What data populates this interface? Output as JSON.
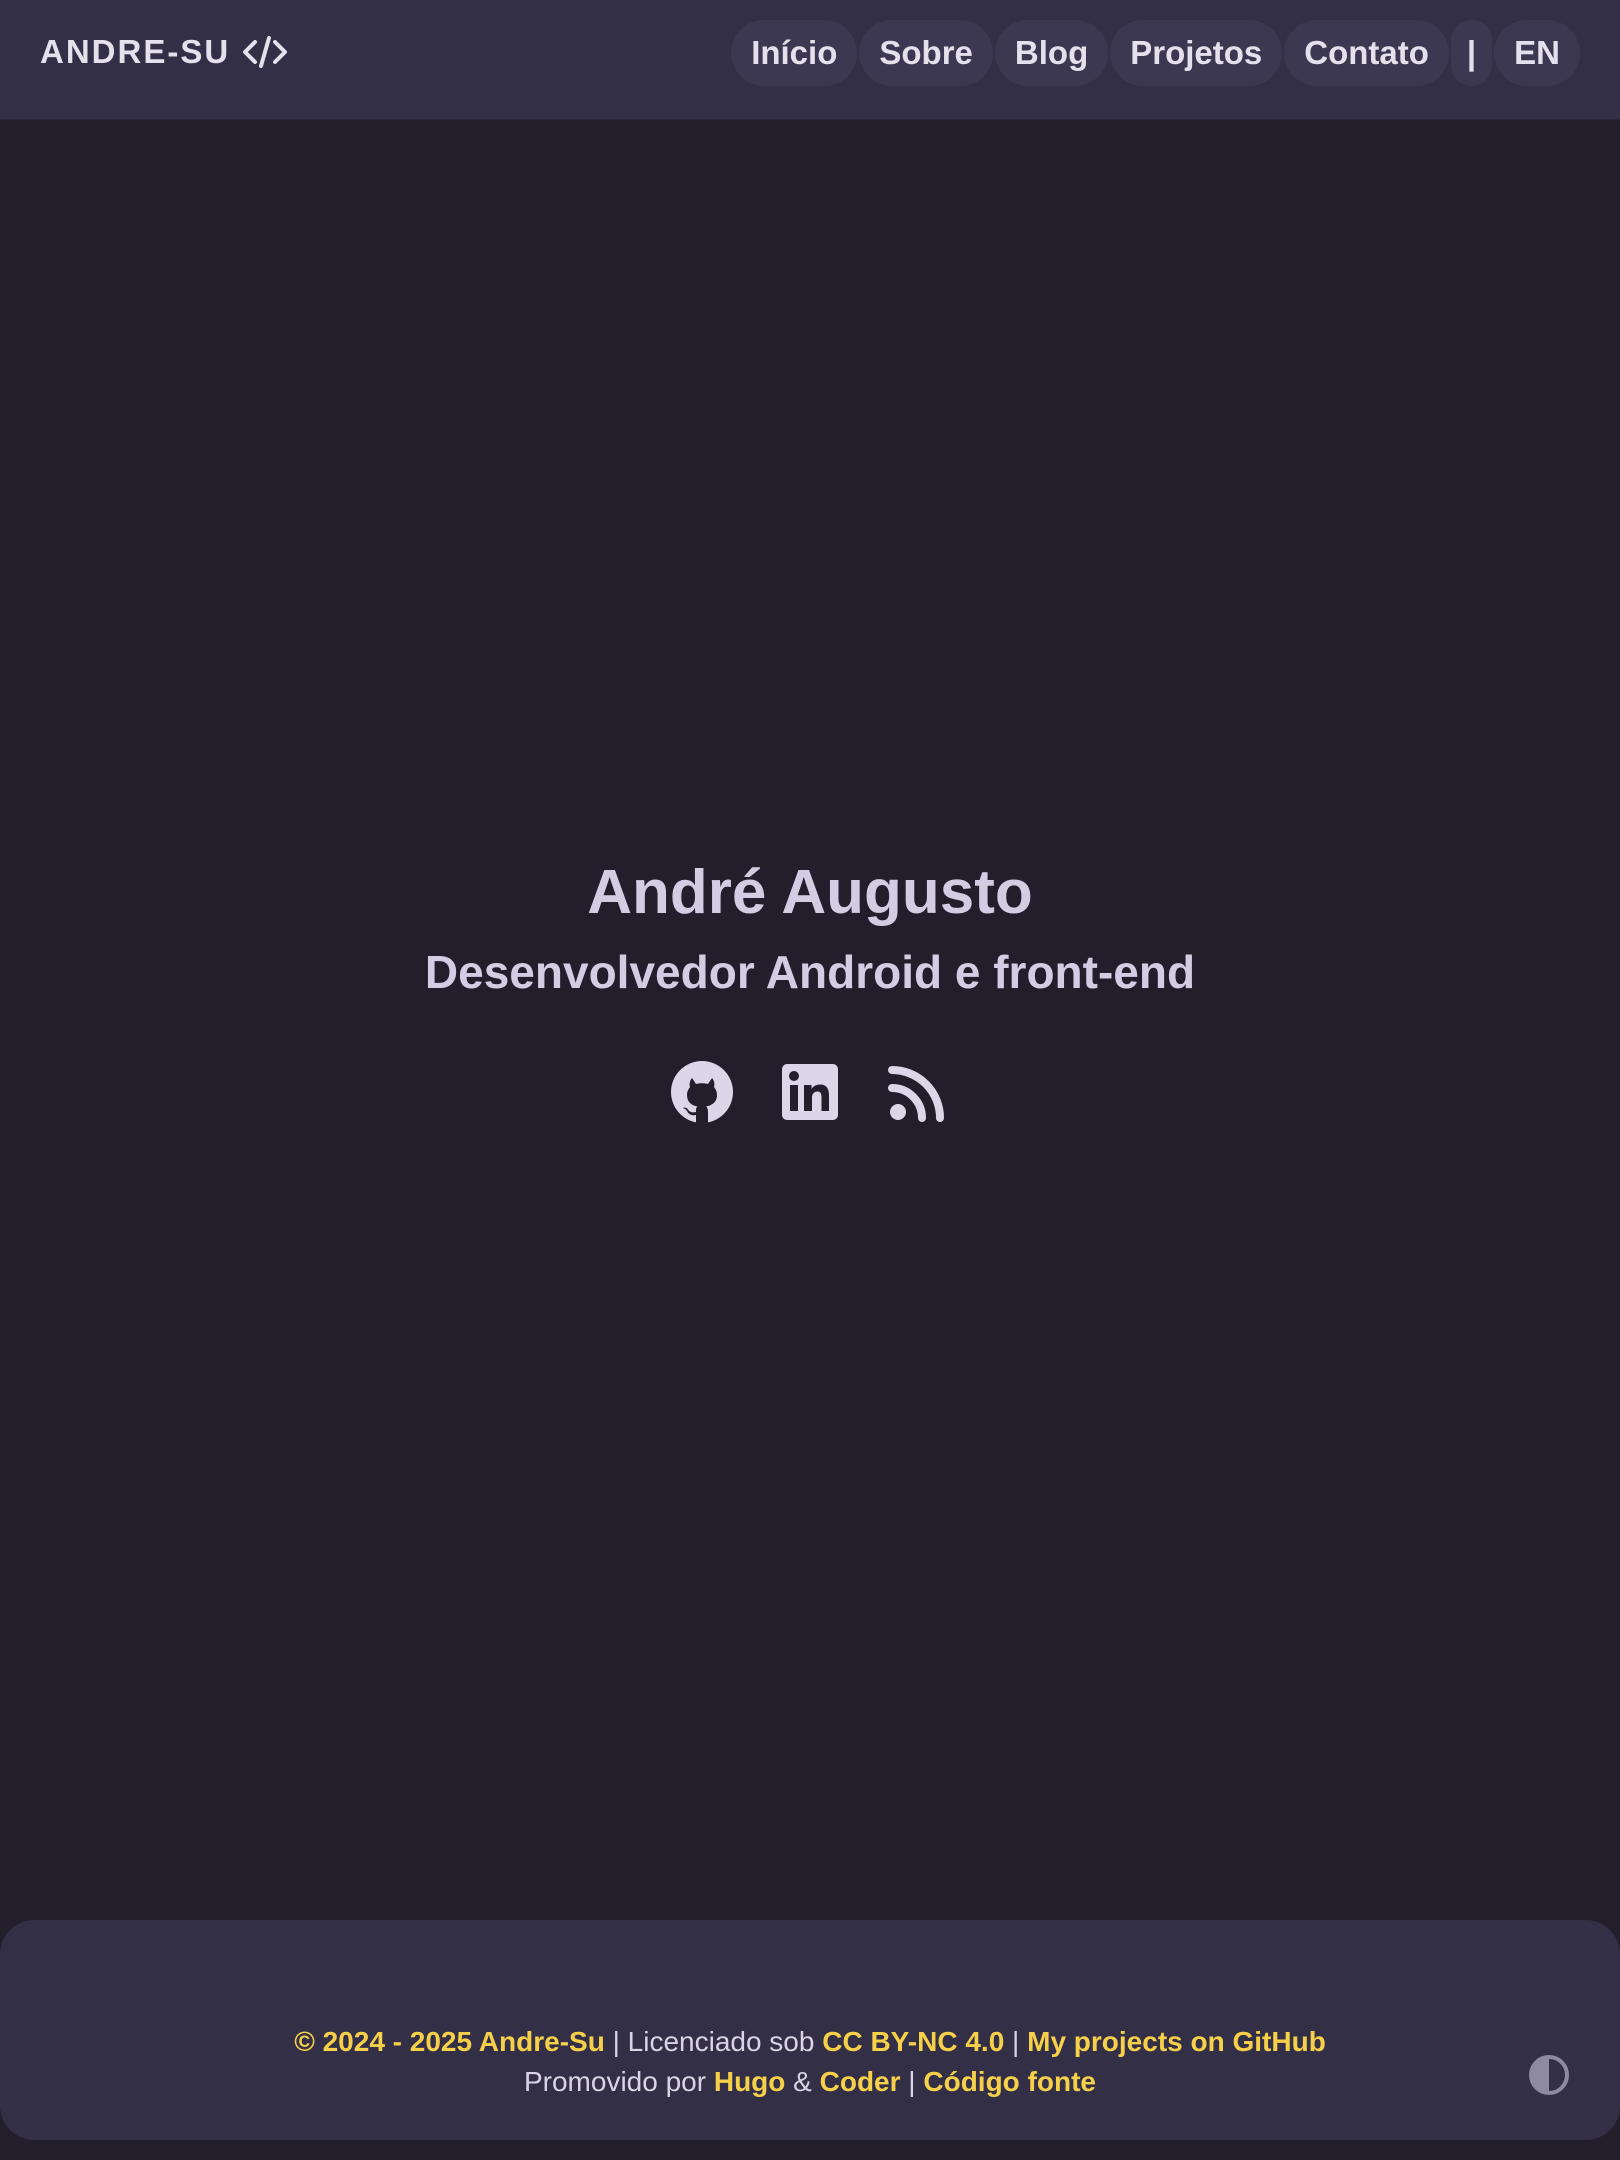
{
  "header": {
    "brand": "ANDRE-SU",
    "brand_icon": "code-icon",
    "nav": [
      {
        "label": "Início"
      },
      {
        "label": "Sobre"
      },
      {
        "label": "Blog"
      },
      {
        "label": "Projetos"
      },
      {
        "label": "Contato"
      }
    ],
    "separator": "|",
    "language": "EN"
  },
  "hero": {
    "name": "André Augusto",
    "role": "Desenvolvedor Android e front-end",
    "socials": [
      {
        "icon": "github-icon"
      },
      {
        "icon": "linkedin-icon"
      },
      {
        "icon": "rss-icon"
      }
    ]
  },
  "footer": {
    "copyright": "© 2024 - 2025 Andre-Su",
    "sep1": " | ",
    "licensed_text": "Licenciado sob ",
    "license": "CC BY-NC 4.0",
    "sep2": " | ",
    "github_link": "My projects on GitHub",
    "powered_text": "Promovido por ",
    "hugo": "Hugo",
    "amp": " & ",
    "coder": "Coder",
    "sep3": " | ",
    "source": "Código fonte",
    "theme_toggle_icon": "contrast-icon"
  },
  "colors": {
    "background": "#221e2b",
    "surface": "#332f46",
    "pill": "#3d3852",
    "accent": "#f7d04a",
    "text": "#dcd6e8"
  }
}
